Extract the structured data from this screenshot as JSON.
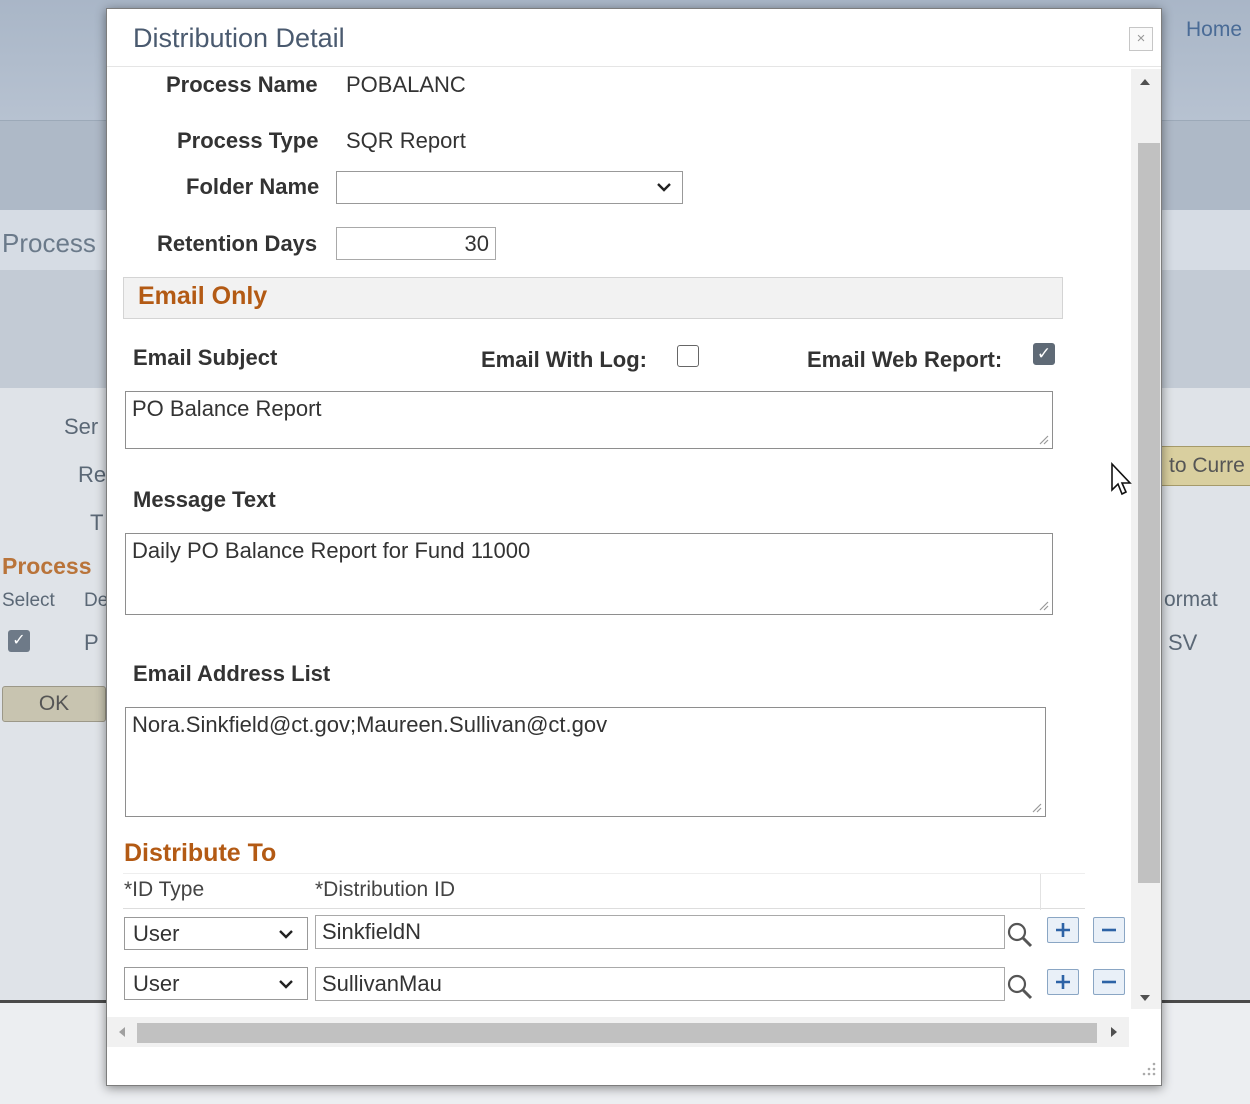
{
  "background": {
    "home_link": "Home",
    "page_title": "Process",
    "label_ser": "Ser",
    "label_re": "Re",
    "label_t": "T",
    "section_process": "Process",
    "col_select": "Select",
    "col_d": "De",
    "row_p": "P",
    "ok_button": "OK",
    "to_current_button": "to Curre",
    "col_format": "ormat",
    "row_format_value": "SV"
  },
  "dialog": {
    "title": "Distribution Detail",
    "close_label": "×",
    "process_name_label": "Process Name",
    "process_name": "POBALANC",
    "process_type_label": "Process Type",
    "process_type": "SQR Report",
    "folder_name_label": "Folder Name",
    "folder_name": "",
    "retention_days_label": "Retention Days",
    "retention_days": "30"
  },
  "email_only": {
    "section_title": "Email Only",
    "subject_label": "Email Subject",
    "with_log_label": "Email With Log:",
    "with_log_checked": false,
    "web_report_label": "Email Web Report:",
    "web_report_checked": true,
    "subject_value": "PO Balance Report",
    "message_label": "Message Text",
    "message_value": "Daily PO Balance Report for Fund 11000",
    "address_label": "Email Address List",
    "address_value": "Nora.Sinkfield@ct.gov;Maureen.Sullivan@ct.gov"
  },
  "distribute_to": {
    "section_title": "Distribute To",
    "col_id_type": "*ID Type",
    "col_distribution_id": "*Distribution ID",
    "rows": [
      {
        "id_type": "User",
        "distribution_id": "SinkfieldN"
      },
      {
        "id_type": "User",
        "distribution_id": "SullivanMau"
      }
    ]
  },
  "colors": {
    "section_accent": "#b35a14",
    "title_color": "#4a5a6f"
  }
}
